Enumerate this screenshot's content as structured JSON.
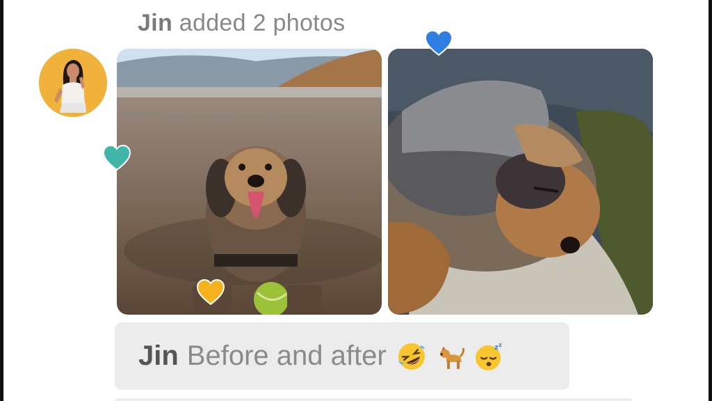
{
  "activity": {
    "sender": "Jin",
    "action_text": "added 2 photos"
  },
  "avatar": {
    "alt": "Jin avatar",
    "bg_color": "#f0b23a"
  },
  "photos": [
    {
      "alt": "Dog on a dirt road with a tennis ball",
      "reaction": "yellow-heart-icon"
    },
    {
      "alt": "Dog sleeping on a couch",
      "reaction": "blue-heart-icon"
    }
  ],
  "reactions": {
    "teal": "#3fb6a8",
    "yellow": "#f5b21c",
    "blue": "#2f7fe0"
  },
  "caption": {
    "sender": "Jin",
    "text": "Before and after",
    "emojis": [
      "rofl-emoji-icon",
      "dog-emoji-icon",
      "sleeping-face-emoji-icon"
    ]
  }
}
